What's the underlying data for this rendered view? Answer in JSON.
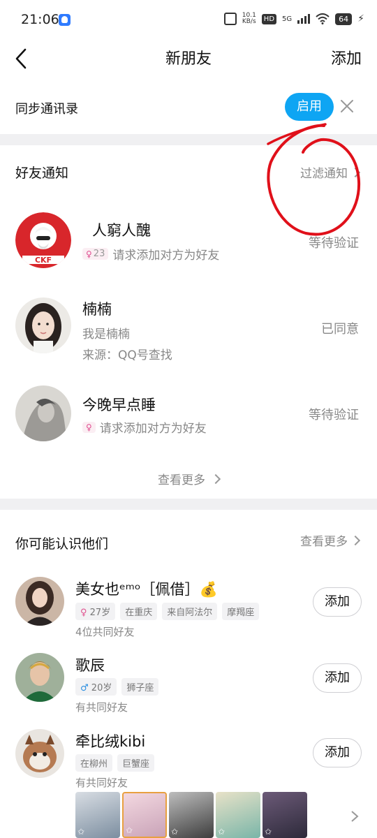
{
  "status_bar": {
    "time": "21:06",
    "net_speed_value": "10.1",
    "net_speed_unit": "KB/s",
    "hd": "HD",
    "network": "5G",
    "battery": "64"
  },
  "nav": {
    "title": "新朋友",
    "add_label": "添加"
  },
  "sync": {
    "label": "同步通讯录",
    "enable_label": "启用",
    "enable_color": "#0ea5f3"
  },
  "friend_notifications": {
    "title": "好友通知",
    "filter_label": "过滤通知",
    "items": [
      {
        "name": "人窮人醜",
        "badge_num": "23",
        "message": "请求添加对方为好友",
        "source": "",
        "status": "等待验证"
      },
      {
        "name": "楠楠",
        "badge_num": "",
        "message": "我是楠楠",
        "source": "来源：QQ号查找",
        "status": "已同意"
      },
      {
        "name": "今晚早点睡",
        "badge_num": "",
        "message": "请求添加对方为好友",
        "source": "",
        "status": "等待验证"
      }
    ],
    "view_more": "查看更多"
  },
  "suggestions": {
    "title": "你可能认识他们",
    "view_more": "查看更多",
    "items": [
      {
        "name": "美女也ᵉᵐᵒ［佩借］💰",
        "tags": [
          "27岁",
          "在重庆",
          "来自阿法尔",
          "摩羯座"
        ],
        "mutual": "4位共同好友",
        "add_label": "添加"
      },
      {
        "name": "歌辰",
        "tags": [
          "20岁",
          "狮子座"
        ],
        "mutual": "有共同好友",
        "add_label": "添加"
      },
      {
        "name": "牵比绒kibi",
        "tags": [
          "在柳州",
          "巨蟹座"
        ],
        "mutual": "有共同好友",
        "add_label": "添加"
      }
    ]
  },
  "annotation_color": "#e0101a"
}
